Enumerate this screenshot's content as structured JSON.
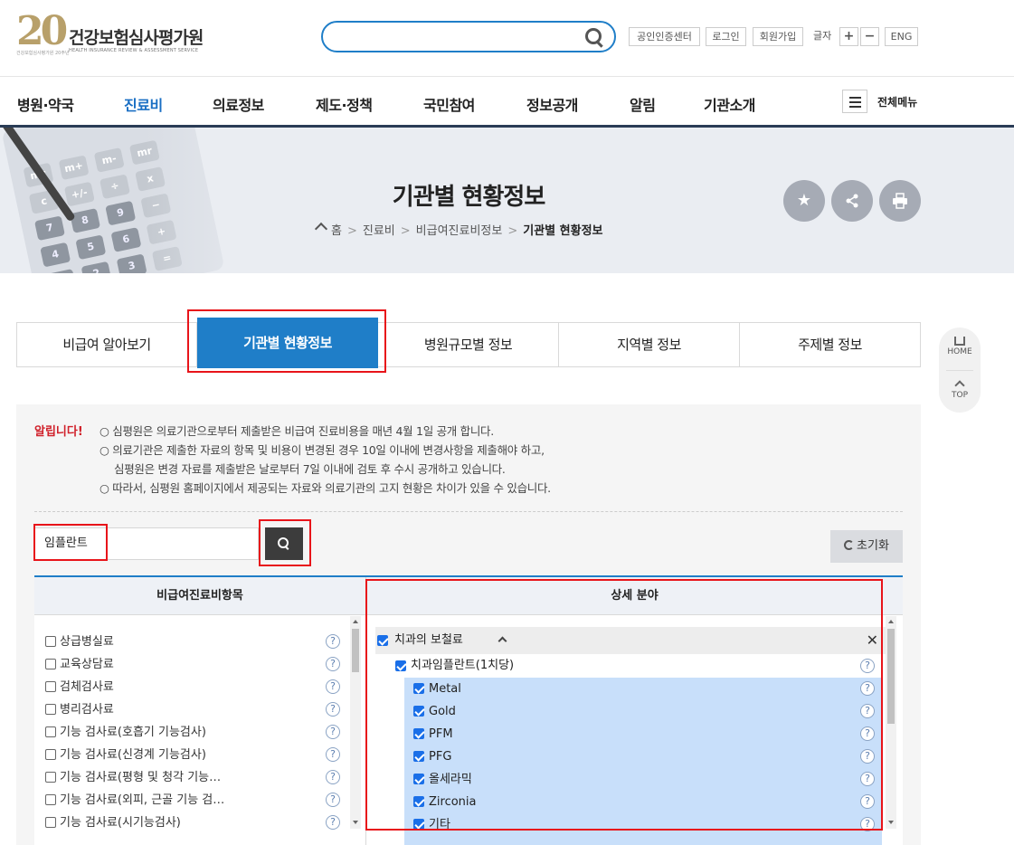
{
  "header": {
    "logo_number": "20",
    "logo_name": "건강보험심사평가원",
    "logo_subtitle": "HEALTH INSURANCE REVIEW & ASSESSMENT SERVICE",
    "logo_tagline": "건강보험심사평가원 20주년",
    "search": {
      "value": "",
      "placeholder": ""
    },
    "util_links": [
      "공인인증센터",
      "로그인",
      "회원가입"
    ],
    "font_size_label": "글자",
    "font_plus": "+",
    "font_minus": "−",
    "lang": "ENG"
  },
  "nav": {
    "items": [
      "병원·약국",
      "진료비",
      "의료정보",
      "제도·정책",
      "국민참여",
      "정보공개",
      "알림",
      "기관소개"
    ],
    "active_index": 1,
    "all_menu_label": "전체메뉴"
  },
  "banner": {
    "title": "기관별 현황정보",
    "breadcrumb": [
      "홈",
      "진료비",
      "비급여진료비정보",
      "기관별 현황정보"
    ],
    "actions": [
      "star-icon",
      "share-icon",
      "print-icon"
    ]
  },
  "tabs": {
    "items": [
      "비급여 알아보기",
      "기관별 현황정보",
      "병원규모별 정보",
      "지역별 정보",
      "주제별 정보"
    ],
    "active_index": 1
  },
  "side_quick": {
    "home": "HOME",
    "top": "TOP"
  },
  "notice": {
    "label": "알립니다!",
    "lines": [
      "○ 심평원은 의료기관으로부터 제출받은 비급여 진료비용을 매년 4월 1일 공개 합니다.",
      "○ 의료기관은 제출한 자료의 항목 및 비용이 변경된 경우 10일 이내에 변경사항을 제출해야 하고,",
      "심평원은 변경 자료를 제출받은 날로부터 7일 이내에 검토 후 수시 공개하고 있습니다.",
      "○ 따라서, 심평원 홈페이지에서 제공되는 자료와 의료기관의 고지 현황은 차이가 있을 수 있습니다."
    ]
  },
  "filter": {
    "keyword": "임플란트",
    "reset_label": "초기화"
  },
  "columns": {
    "left_header": "비급여진료비항목",
    "right_header": "상세 분야"
  },
  "left_items": [
    "상급병실료",
    "교육상담료",
    "검체검사료",
    "병리검사료",
    "기능 검사료(호흡기 기능검사)",
    "기능 검사료(신경계 기능검사)",
    "기능 검사료(평형 및 청각 기능…",
    "기능 검사료(외피, 근골 기능 검…",
    "기능 검사료(시기능검사)"
  ],
  "right_group": {
    "label": "치과의 보철료",
    "sub_label": "치과임플란트(1치당)",
    "items": [
      "Metal",
      "Gold",
      "PFM",
      "PFG",
      "올세라믹",
      "Zirconia",
      "기타"
    ]
  },
  "colors": {
    "accent": "#1f7ec8",
    "highlight": "#e8141a",
    "selected_bg": "#c8dffa",
    "nav_active": "#1a6fc4",
    "notice_label": "#d0202a"
  }
}
